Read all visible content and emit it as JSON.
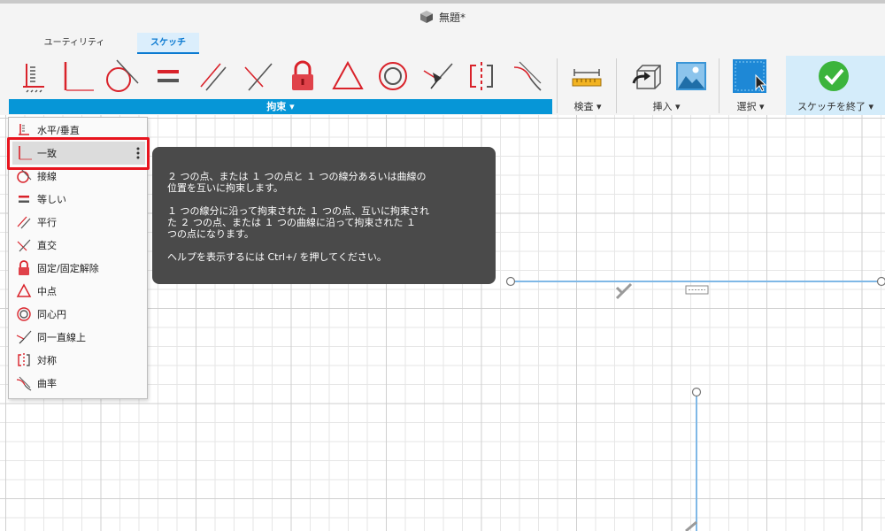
{
  "window": {
    "title": "無題*"
  },
  "ribbon": {
    "tabs": [
      {
        "label": "ユーティリティ",
        "active": false
      },
      {
        "label": "スケッチ",
        "active": true
      }
    ],
    "groups": {
      "constraints": "拘束 ▾",
      "inspect": "検査 ▾",
      "insert": "挿入 ▾",
      "select": "選択 ▾",
      "finish": "スケッチを終了 ▾"
    },
    "constraint_tools": [
      "horizontal-vertical-icon",
      "coincident-icon",
      "tangent-icon",
      "equal-icon",
      "parallel-icon",
      "perpendicular-icon",
      "fix-unfix-icon",
      "midpoint-icon",
      "concentric-icon",
      "collinear-icon",
      "symmetry-icon",
      "curvature-icon"
    ]
  },
  "menu": {
    "items": [
      {
        "label": "水平/垂直",
        "icon": "horizontal-vertical-icon"
      },
      {
        "label": "一致",
        "icon": "coincident-icon"
      },
      {
        "label": "接線",
        "icon": "tangent-icon"
      },
      {
        "label": "等しい",
        "icon": "equal-icon"
      },
      {
        "label": "平行",
        "icon": "parallel-icon"
      },
      {
        "label": "直交",
        "icon": "perpendicular-icon"
      },
      {
        "label": "固定/固定解除",
        "icon": "fix-unfix-icon"
      },
      {
        "label": "中点",
        "icon": "midpoint-icon"
      },
      {
        "label": "同心円",
        "icon": "concentric-icon"
      },
      {
        "label": "同一直線上",
        "icon": "collinear-icon"
      },
      {
        "label": "対称",
        "icon": "symmetry-icon"
      },
      {
        "label": "曲率",
        "icon": "curvature-icon"
      }
    ],
    "selected": "一致"
  },
  "tooltip": {
    "p1": "２ つの点、または １ つの点と １ つの線分あるいは曲線の\n位置を互いに拘束します。",
    "p2": "１ つの線分に沿って拘束された １ つの点、互いに拘束され\nた ２ つの点、または １ つの曲線に沿って拘束された １\nつの点になります。",
    "p3": "ヘルプを表示するには Ctrl+/ を押してください。"
  },
  "colors": {
    "accent": "#0696d7",
    "constraint_red": "#d9222a",
    "highlight": "#e8141e",
    "sketch_line": "#7fb8e6",
    "finish_green": "#3cb43c"
  }
}
